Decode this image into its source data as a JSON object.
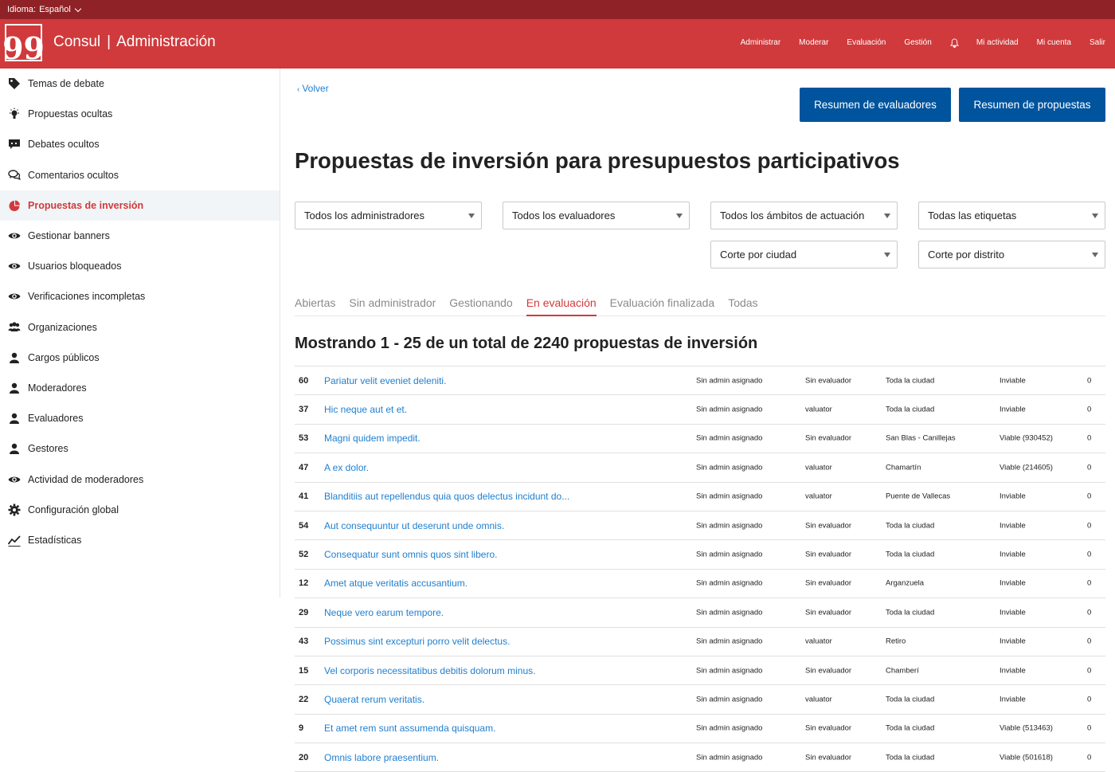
{
  "topbar": {
    "language_label": "Idioma:",
    "language_value": "Español"
  },
  "header": {
    "logo_glyph": "99",
    "brand": "Consul",
    "section": "Administración",
    "nav": [
      "Administrar",
      "Moderar",
      "Evaluación",
      "Gestión",
      "Mi actividad",
      "Mi cuenta",
      "Salir"
    ]
  },
  "sidebar": {
    "items": [
      {
        "label": "Temas de debate",
        "icon": "tag-icon"
      },
      {
        "label": "Propuestas ocultas",
        "icon": "lightbulb-icon"
      },
      {
        "label": "Debates ocultos",
        "icon": "debate-icon"
      },
      {
        "label": "Comentarios ocultos",
        "icon": "comments-icon"
      },
      {
        "label": "Propuestas de inversión",
        "icon": "budget-icon",
        "active": true
      },
      {
        "label": "Gestionar banners",
        "icon": "eye-icon"
      },
      {
        "label": "Usuarios bloqueados",
        "icon": "eye-icon"
      },
      {
        "label": "Verificaciones incompletas",
        "icon": "eye-icon"
      },
      {
        "label": "Organizaciones",
        "icon": "organizations-icon"
      },
      {
        "label": "Cargos públicos",
        "icon": "user-icon"
      },
      {
        "label": "Moderadores",
        "icon": "user-icon"
      },
      {
        "label": "Evaluadores",
        "icon": "user-icon"
      },
      {
        "label": "Gestores",
        "icon": "user-icon"
      },
      {
        "label": "Actividad de moderadores",
        "icon": "eye-icon"
      },
      {
        "label": "Configuración global",
        "icon": "gear-icon"
      },
      {
        "label": "Estadísticas",
        "icon": "stats-icon"
      }
    ]
  },
  "main": {
    "back_label": "Volver",
    "btn_valuators": "Resumen de evaluadores",
    "btn_proposals": "Resumen de propuestas",
    "title": "Propuestas de inversión para presupuestos participativos",
    "filters": {
      "admins": "Todos los administradores",
      "valuators": "Todos los evaluadores",
      "areas": "Todos los ámbitos de actuación",
      "tags": "Todas las etiquetas",
      "city": "Corte por ciudad",
      "district": "Corte por distrito"
    },
    "tabs": [
      "Abiertas",
      "Sin administrador",
      "Gestionando",
      "En evaluación",
      "Evaluación finalizada",
      "Todas"
    ],
    "active_tab": "En evaluación",
    "showing": "Mostrando 1 - 25 de un total de 2240 propuestas de inversión",
    "rows": [
      {
        "id": "60",
        "title": "Pariatur velit eveniet deleniti.",
        "admin": "Sin admin asignado",
        "valuator": "Sin evaluador",
        "geozone": "Toda la ciudad",
        "feasibility": "Inviable",
        "count": "0"
      },
      {
        "id": "37",
        "title": "Hic neque aut et et.",
        "admin": "Sin admin asignado",
        "valuator": "valuator",
        "geozone": "Toda la ciudad",
        "feasibility": "Inviable",
        "count": "0"
      },
      {
        "id": "53",
        "title": "Magni quidem impedit.",
        "admin": "Sin admin asignado",
        "valuator": "Sin evaluador",
        "geozone": "San Blas - Canillejas",
        "feasibility": "Viable (930452)",
        "count": "0"
      },
      {
        "id": "47",
        "title": "A ex dolor.",
        "admin": "Sin admin asignado",
        "valuator": "valuator",
        "geozone": "Chamartín",
        "feasibility": "Viable (214605)",
        "count": "0"
      },
      {
        "id": "41",
        "title": "Blanditiis aut repellendus quia quos delectus incidunt do...",
        "admin": "Sin admin asignado",
        "valuator": "valuator",
        "geozone": "Puente de Vallecas",
        "feasibility": "Inviable",
        "count": "0"
      },
      {
        "id": "54",
        "title": "Aut consequuntur ut deserunt unde omnis.",
        "admin": "Sin admin asignado",
        "valuator": "Sin evaluador",
        "geozone": "Toda la ciudad",
        "feasibility": "Inviable",
        "count": "0"
      },
      {
        "id": "52",
        "title": "Consequatur sunt omnis quos sint libero.",
        "admin": "Sin admin asignado",
        "valuator": "Sin evaluador",
        "geozone": "Toda la ciudad",
        "feasibility": "Inviable",
        "count": "0"
      },
      {
        "id": "12",
        "title": "Amet atque veritatis accusantium.",
        "admin": "Sin admin asignado",
        "valuator": "Sin evaluador",
        "geozone": "Arganzuela",
        "feasibility": "Inviable",
        "count": "0"
      },
      {
        "id": "29",
        "title": "Neque vero earum tempore.",
        "admin": "Sin admin asignado",
        "valuator": "Sin evaluador",
        "geozone": "Toda la ciudad",
        "feasibility": "Inviable",
        "count": "0"
      },
      {
        "id": "43",
        "title": "Possimus sint excepturi porro velit delectus.",
        "admin": "Sin admin asignado",
        "valuator": "valuator",
        "geozone": "Retiro",
        "feasibility": "Inviable",
        "count": "0"
      },
      {
        "id": "15",
        "title": "Vel corporis necessitatibus debitis dolorum minus.",
        "admin": "Sin admin asignado",
        "valuator": "Sin evaluador",
        "geozone": "Chamberí",
        "feasibility": "Inviable",
        "count": "0"
      },
      {
        "id": "22",
        "title": "Quaerat rerum veritatis.",
        "admin": "Sin admin asignado",
        "valuator": "valuator",
        "geozone": "Toda la ciudad",
        "feasibility": "Inviable",
        "count": "0"
      },
      {
        "id": "9",
        "title": "Et amet rem sunt assumenda quisquam.",
        "admin": "Sin admin asignado",
        "valuator": "Sin evaluador",
        "geozone": "Toda la ciudad",
        "feasibility": "Viable (513463)",
        "count": "0"
      },
      {
        "id": "20",
        "title": "Omnis labore praesentium.",
        "admin": "Sin admin asignado",
        "valuator": "Sin evaluador",
        "geozone": "Toda la ciudad",
        "feasibility": "Viable (501618)",
        "count": "0"
      }
    ]
  },
  "colors": {
    "topbar": "#8f2226",
    "header": "#d03a3c",
    "button": "#00549d",
    "link": "#1f7fd0",
    "active": "#d03a3c"
  }
}
